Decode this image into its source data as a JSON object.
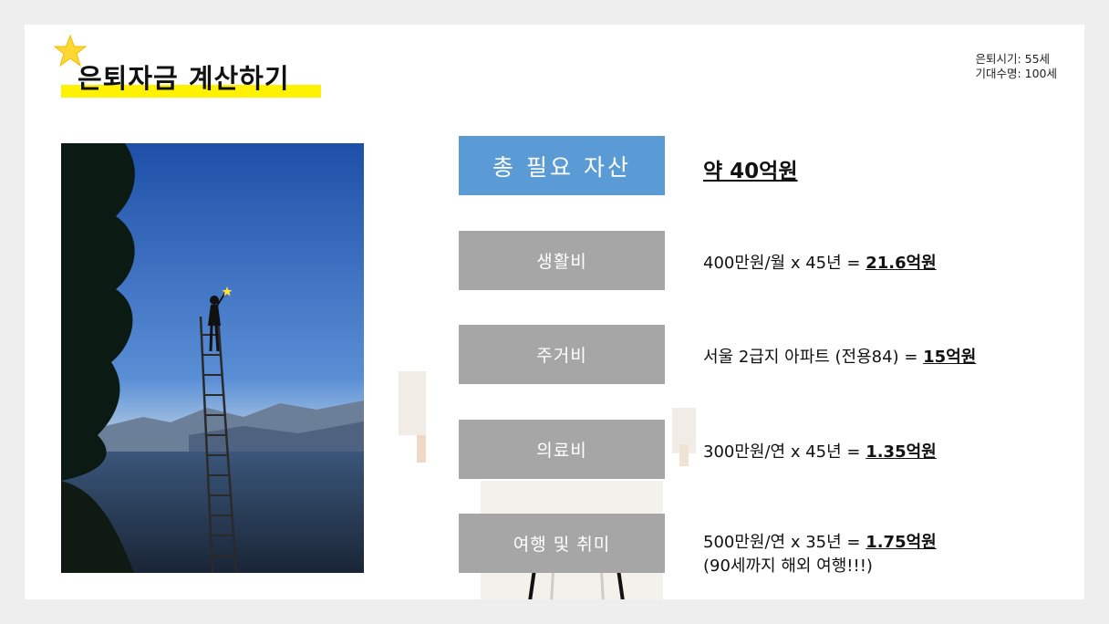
{
  "header": {
    "title": "은퇴자금 계산하기",
    "retire_age": "은퇴시기: 55세",
    "life_expectancy": "기대수명: 100세"
  },
  "summary": {
    "label": "총 필요 자산",
    "value": "약 40억원"
  },
  "items": [
    {
      "label": "생활비",
      "formula": "400만원/월 x 45년  = ",
      "result": "21.6억원"
    },
    {
      "label": "주거비",
      "formula": "서울 2급지 아파트 (전용84) = ",
      "result": "15억원"
    },
    {
      "label": "의료비",
      "formula": "300만원/연 x 45년 = ",
      "result": "1.35억원"
    },
    {
      "label": "여행 및 취미",
      "formula": "500만원/연 x 35년 = ",
      "result": "1.75억원",
      "note": "(90세까지 해외 여행!!!)"
    }
  ],
  "colors": {
    "primary": "#5b9bd5",
    "secondary": "#a6a6a6",
    "highlight": "#fff200"
  }
}
